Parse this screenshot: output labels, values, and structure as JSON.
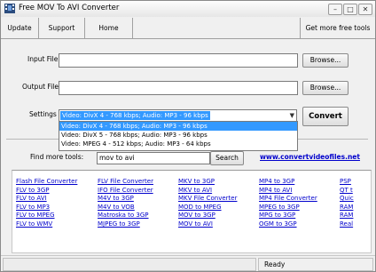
{
  "window": {
    "title": "Free MOV To AVI Converter"
  },
  "menu": {
    "update": "Update",
    "support": "Support",
    "home": "Home",
    "more_tools": "Get more free tools"
  },
  "input": {
    "label": "Input File",
    "value": "",
    "browse": "Browse..."
  },
  "output": {
    "label": "Output File",
    "value": "",
    "browse": "Browse..."
  },
  "settings": {
    "label": "Settings",
    "selected": "Video: DivX 4 - 768 kbps; Audio: MP3 - 96 kbps",
    "options": [
      "Video: DivX 4 - 768 kbps; Audio: MP3 - 96 kbps",
      "Video: DivX 5 - 768 kbps; Audio: MP3 - 96 kbps",
      "Video: MPEG 4 - 512 kbps; Audio: MP3 - 64 kbps"
    ],
    "highlighted_option": 0
  },
  "convert_label": "Convert",
  "find": {
    "label": "Find more tools:",
    "value": "mov to avi",
    "search": "Search",
    "site_link": "www.convertvideofiles.net"
  },
  "links": {
    "col1": [
      "Flash File Converter",
      "FLV to 3GP",
      "FLV to AVI",
      "FLV to MP3",
      "FLV to MPEG",
      "FLV to WMV"
    ],
    "col2": [
      "FLV File Converter",
      "IFO File Converter",
      "M4V to 3GP",
      "M4V to VOB",
      "Matroska to 3GP",
      "MJPEG to 3GP"
    ],
    "col3": [
      "MKV to 3GP",
      "MKV to AVI",
      "MKV File Converter",
      "MOD to MPEG",
      "MOV to 3GP",
      "MOV to AVI"
    ],
    "col4": [
      "MP4 to 3GP",
      "MP4 to AVI",
      "MP4 File Converter",
      "MPEG to 3GP",
      "MPG to 3GP",
      "OGM to 3GP"
    ],
    "col5": [
      "PSP",
      "QT t",
      "Quic",
      "RAM",
      "RAM",
      "Real"
    ]
  },
  "status": {
    "text": "Ready"
  },
  "colors": {
    "link": "#0000cc",
    "selection": "#3399ff"
  }
}
